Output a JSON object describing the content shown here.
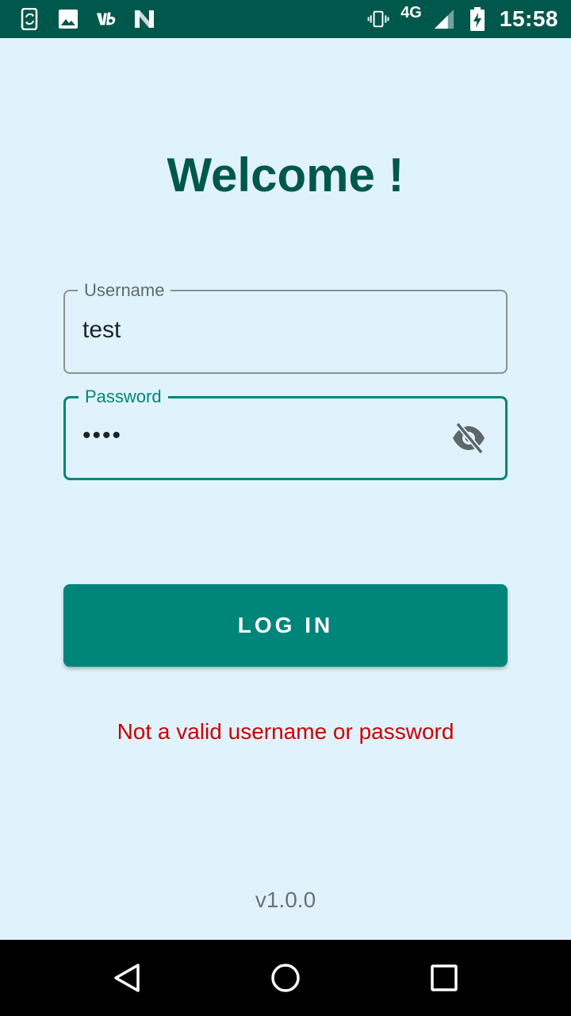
{
  "status_bar": {
    "time": "15:58",
    "network": "4G",
    "icons": [
      "sync-phone-icon",
      "image-icon",
      "app-badge-icon",
      "n-logo-icon",
      "vibrate-icon",
      "signal-icon",
      "battery-charging-icon"
    ],
    "background_color": "#00574b"
  },
  "screen": {
    "background_color": "#e0f3fc",
    "title": "Welcome !",
    "title_color": "#00574b"
  },
  "username_field": {
    "label": "Username",
    "value": "test"
  },
  "password_field": {
    "label": "Password",
    "value": "••••",
    "toggle_icon": "visibility-off-icon",
    "focus_color": "#00857a"
  },
  "login_button": {
    "label": "LOG IN",
    "color": "#00857a"
  },
  "error": {
    "message": "Not a valid username or password",
    "color": "#cc0000"
  },
  "footer": {
    "version": "v1.0.0"
  },
  "nav_bar": {
    "buttons": [
      "back-icon",
      "home-icon",
      "recents-icon"
    ]
  }
}
